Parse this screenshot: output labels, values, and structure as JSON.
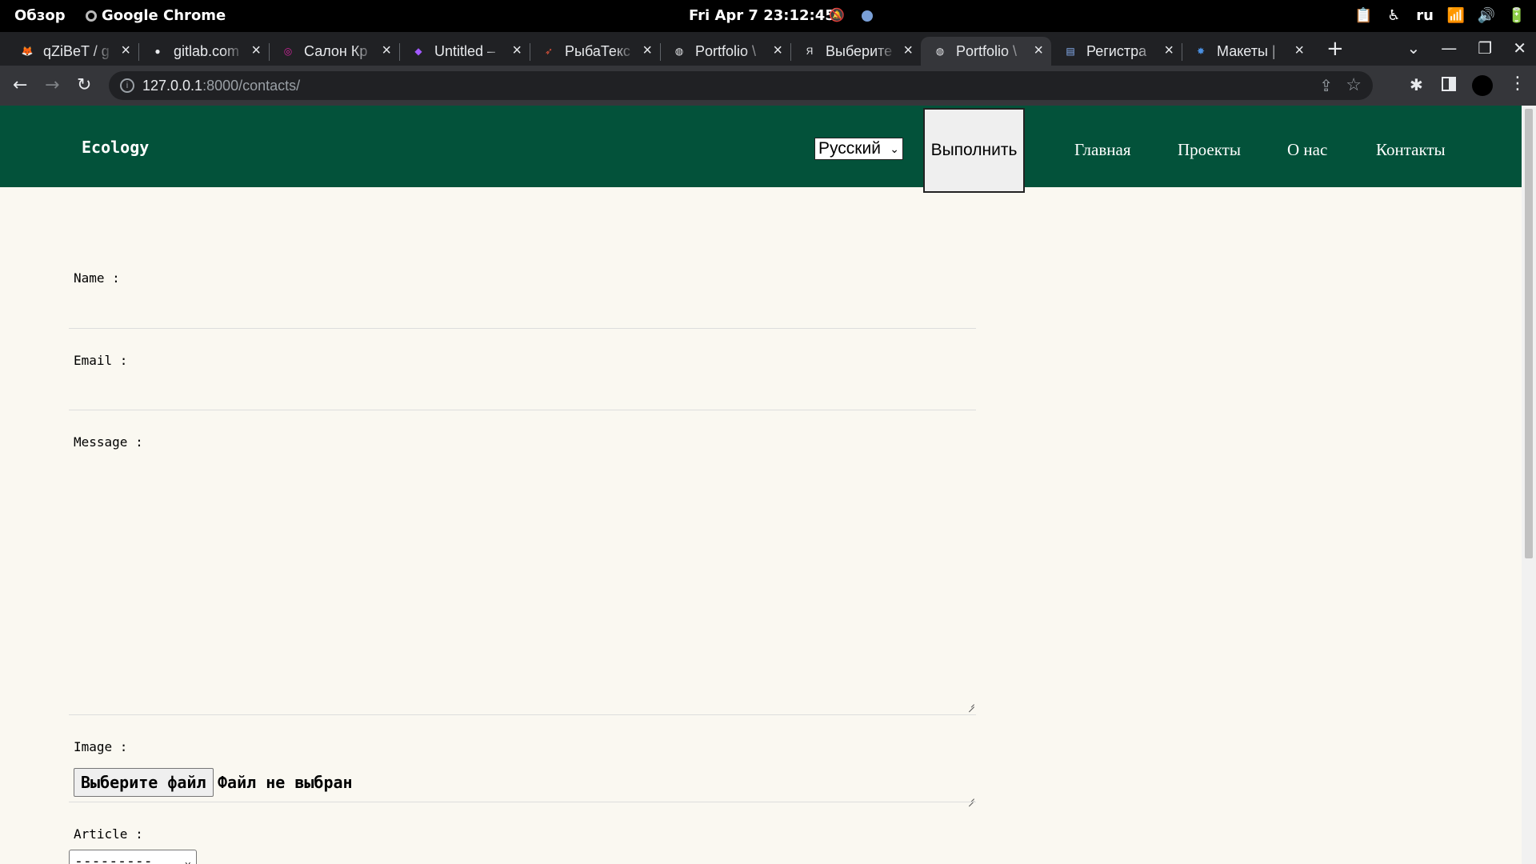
{
  "topbar": {
    "overview": "Обзор",
    "app": "Google Chrome",
    "clock": "Fri Apr 7  23:12:45",
    "lang": "ru"
  },
  "tabs": [
    {
      "title": "qZiBeT / g",
      "icon": "gitlab-icon",
      "color": "#e24329"
    },
    {
      "title": "gitlab.com",
      "icon": "github-icon",
      "color": "#e8eaed"
    },
    {
      "title": "Салон Кр",
      "icon": "instagram-icon",
      "color": "#d6249f"
    },
    {
      "title": "Untitled –",
      "icon": "figma-icon",
      "color": "#a259ff"
    },
    {
      "title": "РыбаТекс",
      "icon": "fish-icon",
      "color": "#e0533a"
    },
    {
      "title": "Portfolio \\",
      "icon": "globe-icon",
      "color": "#e8eaed"
    },
    {
      "title": "Выберите",
      "icon": "yandex-icon",
      "color": "#e8eaed"
    },
    {
      "title": "Portfolio \\",
      "icon": "globe-icon",
      "color": "#e8eaed",
      "active": true
    },
    {
      "title": "Регистра",
      "icon": "doc-icon",
      "color": "#8ab4f8"
    },
    {
      "title": "Макеты |",
      "icon": "star-logo-icon",
      "color": "#4a90e2"
    }
  ],
  "omnibox": {
    "host": "127.0.0.1",
    "path": ":8000/contacts/"
  },
  "site": {
    "brand": "Ecology",
    "language_selected": "Русский",
    "submit_label": "Выполнить",
    "nav": [
      "Главная",
      "Проекты",
      "О нас",
      "Контакты"
    ]
  },
  "form": {
    "name_label": "Name :",
    "email_label": "Email :",
    "message_label": "Message :",
    "image_label": "Image :",
    "file_button": "Выберите файл",
    "file_status": "Файл не выбран",
    "article_label": "Article :",
    "article_selected": "---------"
  },
  "colors": {
    "header_bg": "#03523a",
    "page_bg": "#faf8f1"
  }
}
